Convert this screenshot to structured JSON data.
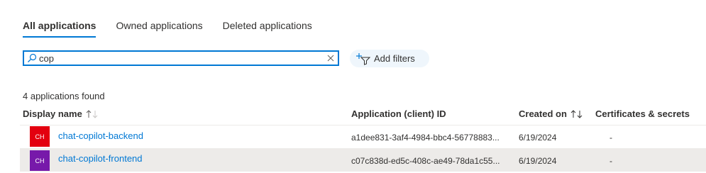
{
  "tabs": [
    {
      "label": "All applications",
      "active": true
    },
    {
      "label": "Owned applications",
      "active": false
    },
    {
      "label": "Deleted applications",
      "active": false
    }
  ],
  "search": {
    "value": "cop",
    "placeholder": ""
  },
  "filters": {
    "label": "Add filters"
  },
  "results": {
    "count_text": "4 applications found"
  },
  "columns": {
    "display_name": "Display name",
    "client_id": "Application (client) ID",
    "created_on": "Created on",
    "certificates": "Certificates & secrets"
  },
  "rows": [
    {
      "initials": "CH",
      "avatar_color": "#e3000f",
      "name": "chat-copilot-backend",
      "client_id": "a1dee831-3af4-4984-bbc4-56778883...",
      "created_on": "6/19/2024",
      "certificates": "-"
    },
    {
      "initials": "CH",
      "avatar_color": "#7719aa",
      "name": "chat-copilot-frontend",
      "client_id": "c07c838d-ed5c-408c-ae49-78da1c55...",
      "created_on": "6/19/2024",
      "certificates": "-"
    }
  ],
  "colors": {
    "accent": "#0078d4",
    "selected_row": "#edebe9",
    "filter_bg": "#eff6fc"
  }
}
